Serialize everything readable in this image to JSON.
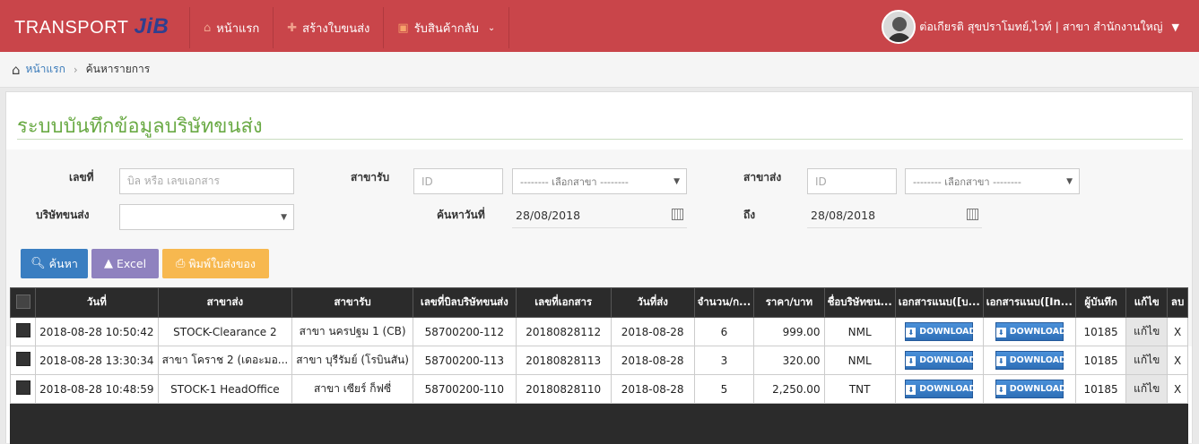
{
  "header": {
    "brand_text": "TRANSPORT",
    "brand_logo": "JiB",
    "nav": [
      {
        "label": "หน้าแรก",
        "icon": "home-icon"
      },
      {
        "label": "สร้างใบขนส่ง",
        "icon": "plus-icon"
      },
      {
        "label": "รับสินค้ากลับ",
        "icon": "car-icon"
      }
    ],
    "user_name": "ต่อเกียรติ สุขปราโมทย์,ไวท์ | สาขา สำนักงานใหญ่"
  },
  "breadcrumb": {
    "home": "หน้าแรก",
    "current": "ค้นหารายการ"
  },
  "page_title": "ระบบบันทึกข้อมูลบริษัทขนส่ง",
  "form": {
    "doc_no_label": "เลขที่",
    "doc_no_placeholder": "บิล หรือ เลขเอกสาร",
    "recv_branch_label": "สาขารับ",
    "recv_branch_id_placeholder": "ID",
    "recv_branch_select": "-------- เลือกสาขา --------",
    "send_branch_label": "สาขาส่ง",
    "send_branch_id_placeholder": "ID",
    "send_branch_select": "-------- เลือกสาขา --------",
    "company_label": "บริษัทขนส่ง",
    "company_select": "",
    "date_from_label": "ค้นหาวันที่",
    "date_from": "28/08/2018",
    "date_to_label": "ถึง",
    "date_to": "28/08/2018"
  },
  "buttons": {
    "search": "ค้นหา",
    "excel": "Excel",
    "print": "พิมพ์ใบส่งของ"
  },
  "colors": {
    "header": "#c9454a",
    "title": "#6aaa45",
    "search_btn": "#3a7ec1",
    "excel_btn": "#8f82bf",
    "print_btn": "#f7b84f"
  },
  "table": {
    "headers": [
      "วันที่",
      "สาขาส่ง",
      "สาขารับ",
      "เลขที่บิลบริษัทขนส่ง",
      "เลขที่เอกสาร",
      "วันที่ส่ง",
      "จำนวน/ก...",
      "ราคา/บาท",
      "ชื่อบริษัทขน...",
      "เอกสารแนบ([บ...",
      "เอกสารแนบ([In...",
      "ผู้บันทึก",
      "แก้ไข",
      "ลบ"
    ],
    "download_label": "DOWNLOAD",
    "edit_label": "แก้ไข",
    "delete_label": "X",
    "rows": [
      {
        "date": "2018-08-28 10:50:42",
        "send": "STOCK-Clearance 2",
        "recv": "สาขา นครปฐม 1 (CB)",
        "bill": "58700200-112",
        "doc": "20180828112",
        "ship_date": "2018-08-28",
        "qty": "6",
        "price": "999.00",
        "company": "NML",
        "user": "10185"
      },
      {
        "date": "2018-08-28 13:30:34",
        "send": "สาขา โคราช 2 (เดอะมอ...",
        "recv": "สาขา บุรีรัมย์ (โรบินสัน)",
        "bill": "58700200-113",
        "doc": "20180828113",
        "ship_date": "2018-08-28",
        "qty": "3",
        "price": "320.00",
        "company": "NML",
        "user": "10185"
      },
      {
        "date": "2018-08-28 10:48:59",
        "send": "STOCK-1 HeadOffice",
        "recv": "สาขา เซียร์ ก็ฟซี่",
        "bill": "58700200-110",
        "doc": "20180828110",
        "ship_date": "2018-08-28",
        "qty": "5",
        "price": "2,250.00",
        "company": "TNT",
        "user": "10185"
      }
    ]
  }
}
